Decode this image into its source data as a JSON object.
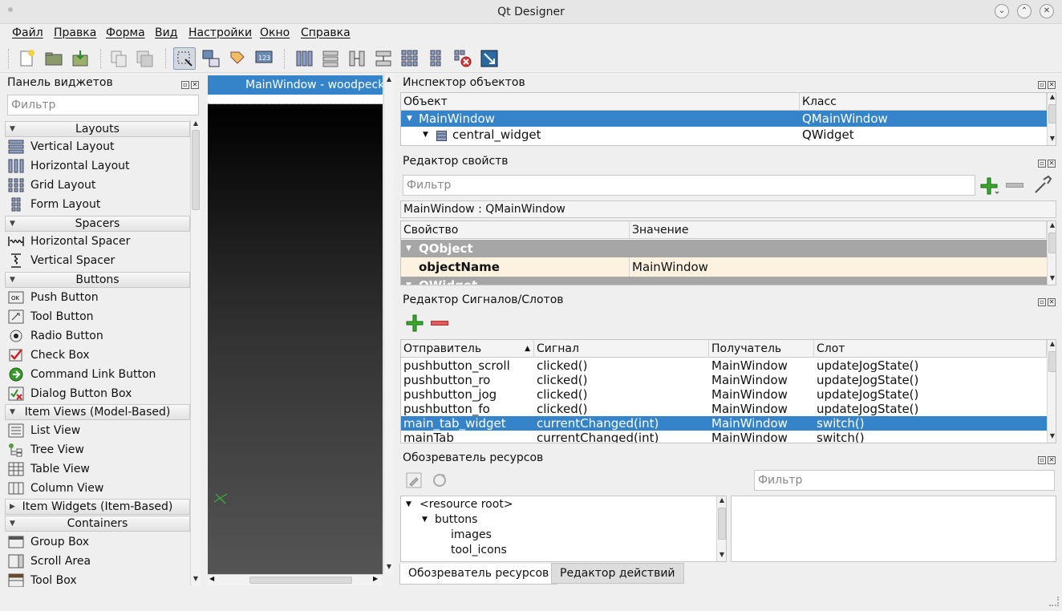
{
  "window": {
    "title": "Qt Designer"
  },
  "menu": [
    "Файл",
    "Правка",
    "Форма",
    "Вид",
    "Настройки",
    "Окно",
    "Справка"
  ],
  "widget_box": {
    "title": "Панель виджетов",
    "filter_placeholder": "Фильтр",
    "categories": {
      "layouts": "Layouts",
      "spacers": "Spacers",
      "buttons": "Buttons",
      "item_views": "Item Views (Model-Based)",
      "item_widgets": "Item Widgets (Item-Based)",
      "containers": "Containers"
    },
    "items": {
      "vertical_layout": "Vertical Layout",
      "horizontal_layout": "Horizontal Layout",
      "grid_layout": "Grid Layout",
      "form_layout": "Form Layout",
      "horizontal_spacer": "Horizontal Spacer",
      "vertical_spacer": "Vertical Spacer",
      "push_button": "Push Button",
      "tool_button": "Tool Button",
      "radio_button": "Radio Button",
      "check_box": "Check Box",
      "command_link_button": "Command Link Button",
      "dialog_button_box": "Dialog Button Box",
      "list_view": "List View",
      "tree_view": "Tree View",
      "table_view": "Table View",
      "column_view": "Column View",
      "group_box": "Group Box",
      "scroll_area": "Scroll Area",
      "tool_box": "Tool Box"
    }
  },
  "form": {
    "title": "MainWindow - woodpeck"
  },
  "object_inspector": {
    "title": "Инспектор объектов",
    "col_object": "Объект",
    "col_class": "Класс",
    "rows": [
      {
        "object": "MainWindow",
        "class": "QMainWindow"
      },
      {
        "object": "central_widget",
        "class": "QWidget"
      }
    ]
  },
  "property_editor": {
    "title": "Редактор свойств",
    "filter_placeholder": "Фильтр",
    "context": "MainWindow : QMainWindow",
    "col_property": "Свойство",
    "col_value": "Значение",
    "group1": "QObject",
    "prop_name": "objectName",
    "prop_value": "MainWindow",
    "group2": "QWidget"
  },
  "signal_slot_editor": {
    "title": "Редактор Сигналов/Слотов",
    "cols": {
      "sender": "Отправитель",
      "signal": "Сигнал",
      "receiver": "Получатель",
      "slot": "Слот"
    },
    "rows": [
      {
        "sender": "pushbutton_scroll",
        "signal": "clicked()",
        "receiver": "MainWindow",
        "slot": "updateJogState()"
      },
      {
        "sender": "pushbutton_ro",
        "signal": "clicked()",
        "receiver": "MainWindow",
        "slot": "updateJogState()"
      },
      {
        "sender": "pushbutton_jog",
        "signal": "clicked()",
        "receiver": "MainWindow",
        "slot": "updateJogState()"
      },
      {
        "sender": "pushbutton_fo",
        "signal": "clicked()",
        "receiver": "MainWindow",
        "slot": "updateJogState()"
      },
      {
        "sender": "main_tab_widget",
        "signal": "currentChanged(int)",
        "receiver": "MainWindow",
        "slot": "switch()"
      },
      {
        "sender": "mainTab",
        "signal": "currentChanged(int)",
        "receiver": "MainWindow",
        "slot": "switch()"
      }
    ]
  },
  "resource_browser": {
    "title": "Обозреватель ресурсов",
    "filter_placeholder": "Фильтр",
    "tree": {
      "root": "<resource root>",
      "buttons": "buttons",
      "images": "images",
      "tool_icons": "tool_icons"
    }
  },
  "bottom_tabs": {
    "resources": "Обозреватель ресурсов",
    "actions": "Редактор действий"
  }
}
